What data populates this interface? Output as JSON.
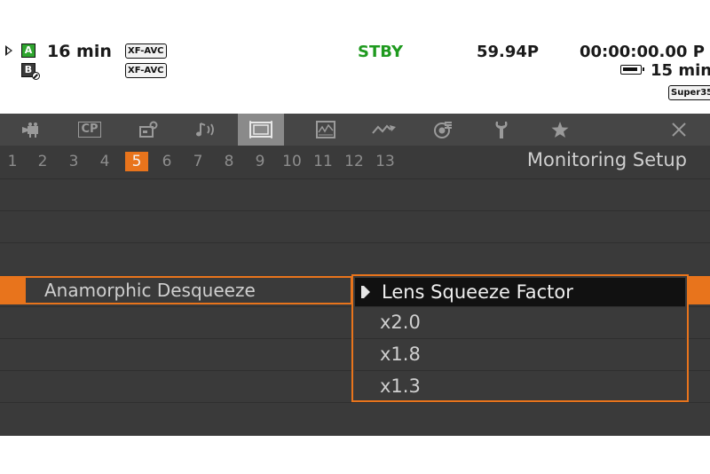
{
  "status": {
    "card_a_label": "A",
    "card_b_label": "B",
    "remaining_time": "16 min",
    "format_1": "XF-AVC",
    "format_2": "XF-AVC",
    "record_state": "STBY",
    "frame_rate": "59.94P",
    "timecode": "00:00:00.00 P",
    "battery_time": "15 min",
    "sensor_mode": "Super35",
    "record_state_color": "#1f9a1f"
  },
  "tabs": [
    {
      "icon": "camera-icon"
    },
    {
      "icon": "cp-icon",
      "label": "CP"
    },
    {
      "icon": "camera-settings-icon"
    },
    {
      "icon": "audio-icon"
    },
    {
      "icon": "monitoring-icon",
      "active": true
    },
    {
      "icon": "waveform-icon"
    },
    {
      "icon": "assist-icon"
    },
    {
      "icon": "custom-picture-icon"
    },
    {
      "icon": "wrench-icon"
    },
    {
      "icon": "star-icon"
    },
    {
      "icon": "close-icon"
    }
  ],
  "pages": [
    "1",
    "2",
    "3",
    "4",
    "5",
    "6",
    "7",
    "8",
    "9",
    "10",
    "11",
    "12",
    "13"
  ],
  "active_page": "5",
  "menu_title": "Monitoring Setup",
  "selected_item": {
    "label": "Anamorphic Desqueeze"
  },
  "dropdown": {
    "title": "Lens Squeeze Factor",
    "options": [
      "x2.0",
      "x1.8",
      "x1.3"
    ]
  },
  "colors": {
    "accent": "#e8741c",
    "panel": "#3a3a3a"
  }
}
